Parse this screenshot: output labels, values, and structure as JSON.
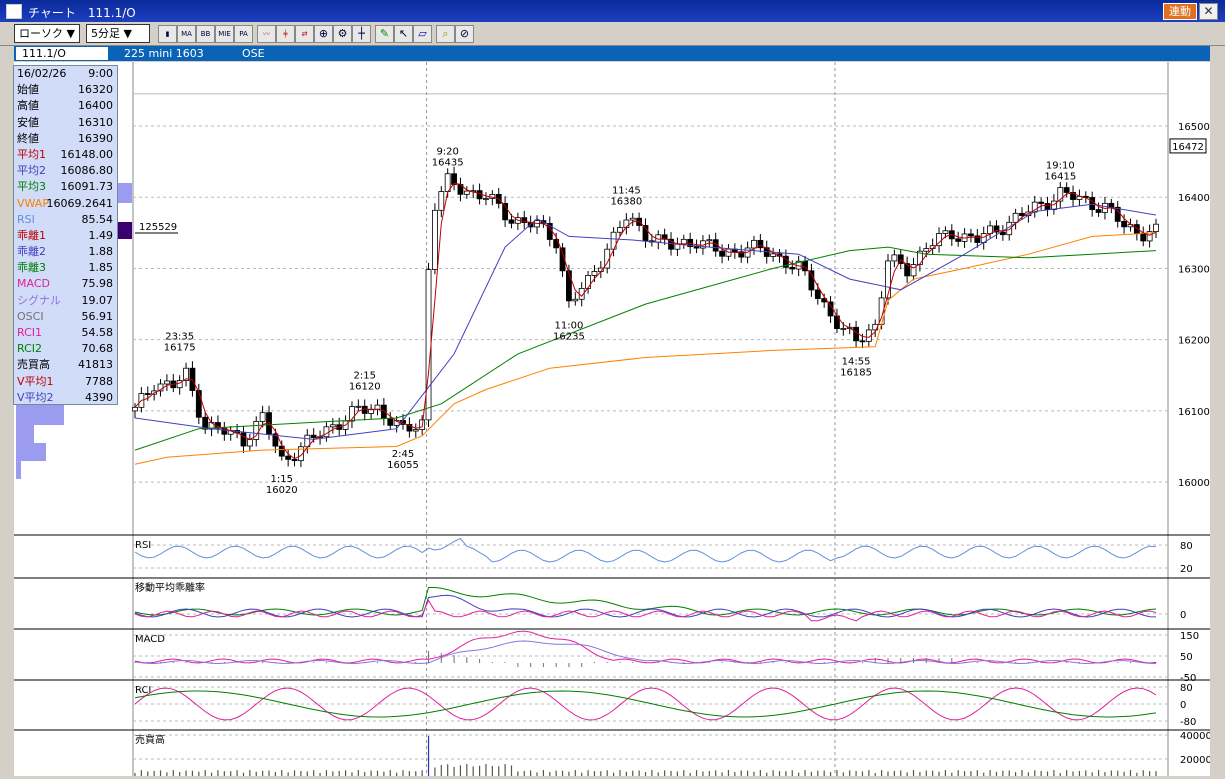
{
  "window": {
    "title": "チャート　111.1/O",
    "sync_label": "連動",
    "close_label": "✕"
  },
  "toolbar": {
    "chart_type": "ローソク ▼",
    "interval": "5分足 ▼",
    "tools": [
      "MA",
      "BB",
      "MIE",
      "PA",
      "line-chart-icon",
      "candle-icon",
      "swap-icon",
      "zoom-icon",
      "settings-icon",
      "crosshair-icon",
      "pen-icon",
      "cursor-icon",
      "eraser-icon",
      "search-icon",
      "clear-icon"
    ]
  },
  "infobar": {
    "symbol": "111.1/O",
    "product": "225 mini 1603",
    "exchange": "OSE"
  },
  "datapanel": {
    "rows": [
      {
        "k": "16/02/26",
        "v": "9:00",
        "c": "#000"
      },
      {
        "k": "始値",
        "v": "16320",
        "c": "#000"
      },
      {
        "k": "高値",
        "v": "16400",
        "c": "#000"
      },
      {
        "k": "安値",
        "v": "16310",
        "c": "#000"
      },
      {
        "k": "終値",
        "v": "16390",
        "c": "#000"
      },
      {
        "k": "平均1",
        "v": "16148.00",
        "c": "#c00000"
      },
      {
        "k": "平均2",
        "v": "16086.80",
        "c": "#4040c0"
      },
      {
        "k": "平均3",
        "v": "16091.73",
        "c": "#008000"
      },
      {
        "k": "VWAP",
        "v": "16069.2641",
        "c": "#ff8000"
      },
      {
        "k": "RSI",
        "v": "85.54",
        "c": "#6090e0"
      },
      {
        "k": "乖離1",
        "v": "1.49",
        "c": "#c00000"
      },
      {
        "k": "乖離2",
        "v": "1.88",
        "c": "#4040c0"
      },
      {
        "k": "乖離3",
        "v": "1.85",
        "c": "#008000"
      },
      {
        "k": "MACD",
        "v": "75.98",
        "c": "#e0209a"
      },
      {
        "k": "シグナル",
        "v": "19.07",
        "c": "#9070e0"
      },
      {
        "k": "OSCI",
        "v": "56.91",
        "c": "#707070"
      },
      {
        "k": "RCI1",
        "v": "54.58",
        "c": "#e0209a"
      },
      {
        "k": "RCI2",
        "v": "70.68",
        "c": "#008000"
      },
      {
        "k": "売買高",
        "v": "41813",
        "c": "#000"
      },
      {
        "k": "V平均1",
        "v": "7788",
        "c": "#c00000"
      },
      {
        "k": "V平均2",
        "v": "4390",
        "c": "#4040c0"
      }
    ]
  },
  "volume_profile_label": "125529",
  "current_price_label": "16472",
  "colors": {
    "up": "#ffffff",
    "down": "#000000",
    "ma1": "#c00000",
    "ma2": "#4040c0",
    "ma3": "#008000",
    "vwap": "#ff8000",
    "rsi": "#6090e0",
    "macd": "#e0209a",
    "signal": "#9070e0",
    "osci": "#707070",
    "rci2": "#008000",
    "grid": "#bbbbbb"
  },
  "chart_data": {
    "type": "candlestick",
    "date": "16/02/26",
    "ylim": [
      15930,
      16580
    ],
    "yticks": [
      16000,
      16100,
      16200,
      16300,
      16400,
      16500
    ],
    "x_range": [
      0,
      160
    ],
    "annotations": [
      {
        "time": "23:35",
        "price": 16175,
        "i": 7,
        "pos": "above"
      },
      {
        "time": "1:15",
        "price": 16020,
        "i": 23,
        "pos": "below"
      },
      {
        "time": "2:15",
        "price": 16120,
        "i": 36,
        "pos": "above"
      },
      {
        "time": "2:45",
        "price": 16055,
        "i": 42,
        "pos": "below"
      },
      {
        "time": "9:20",
        "price": 16435,
        "i": 49,
        "pos": "above"
      },
      {
        "time": "11:00",
        "price": 16235,
        "i": 68,
        "pos": "below"
      },
      {
        "time": "11:45",
        "price": 16380,
        "i": 77,
        "pos": "above"
      },
      {
        "time": "14:55",
        "price": 16185,
        "i": 113,
        "pos": "below"
      },
      {
        "time": "19:10",
        "price": 16415,
        "i": 145,
        "pos": "above"
      }
    ],
    "anchors": [
      [
        0,
        16100
      ],
      [
        3,
        16140
      ],
      [
        6,
        16135
      ],
      [
        8,
        16150
      ],
      [
        11,
        16080
      ],
      [
        14,
        16070
      ],
      [
        17,
        16060
      ],
      [
        20,
        16090
      ],
      [
        23,
        16030
      ],
      [
        27,
        16055
      ],
      [
        31,
        16080
      ],
      [
        35,
        16100
      ],
      [
        38,
        16105
      ],
      [
        42,
        16070
      ],
      [
        45,
        16085
      ],
      [
        46,
        16300
      ],
      [
        47,
        16390
      ],
      [
        49,
        16420
      ],
      [
        52,
        16410
      ],
      [
        55,
        16400
      ],
      [
        59,
        16370
      ],
      [
        63,
        16360
      ],
      [
        66,
        16340
      ],
      [
        68,
        16250
      ],
      [
        71,
        16280
      ],
      [
        74,
        16330
      ],
      [
        77,
        16370
      ],
      [
        80,
        16350
      ],
      [
        84,
        16330
      ],
      [
        88,
        16340
      ],
      [
        92,
        16320
      ],
      [
        96,
        16330
      ],
      [
        100,
        16320
      ],
      [
        104,
        16300
      ],
      [
        108,
        16250
      ],
      [
        111,
        16210
      ],
      [
        113,
        16200
      ],
      [
        116,
        16220
      ],
      [
        118,
        16310
      ],
      [
        121,
        16300
      ],
      [
        124,
        16330
      ],
      [
        128,
        16350
      ],
      [
        132,
        16340
      ],
      [
        136,
        16360
      ],
      [
        140,
        16380
      ],
      [
        143,
        16395
      ],
      [
        145,
        16405
      ],
      [
        149,
        16395
      ],
      [
        152,
        16385
      ],
      [
        155,
        16360
      ],
      [
        158,
        16350
      ],
      [
        160,
        16350
      ]
    ],
    "ma2": [
      [
        0,
        16090
      ],
      [
        12,
        16075
      ],
      [
        28,
        16060
      ],
      [
        41,
        16075
      ],
      [
        50,
        16180
      ],
      [
        58,
        16330
      ],
      [
        63,
        16370
      ],
      [
        68,
        16345
      ],
      [
        78,
        16340
      ],
      [
        90,
        16330
      ],
      [
        104,
        16320
      ],
      [
        112,
        16285
      ],
      [
        120,
        16270
      ],
      [
        130,
        16320
      ],
      [
        141,
        16380
      ],
      [
        150,
        16390
      ],
      [
        160,
        16375
      ]
    ],
    "ma3": [
      [
        0,
        16045
      ],
      [
        10,
        16075
      ],
      [
        30,
        16085
      ],
      [
        41,
        16090
      ],
      [
        48,
        16110
      ],
      [
        60,
        16180
      ],
      [
        80,
        16250
      ],
      [
        100,
        16300
      ],
      [
        112,
        16325
      ],
      [
        118,
        16330
      ],
      [
        124,
        16320
      ],
      [
        140,
        16315
      ],
      [
        150,
        16320
      ],
      [
        160,
        16325
      ]
    ],
    "vwap": [
      [
        0,
        16025
      ],
      [
        5,
        16035
      ],
      [
        20,
        16045
      ],
      [
        41,
        16050
      ],
      [
        45,
        16065
      ],
      [
        50,
        16110
      ],
      [
        55,
        16130
      ],
      [
        65,
        16160
      ],
      [
        80,
        16175
      ],
      [
        100,
        16185
      ],
      [
        116,
        16190
      ],
      [
        118,
        16255
      ],
      [
        122,
        16285
      ],
      [
        130,
        16300
      ],
      [
        140,
        16320
      ],
      [
        150,
        16345
      ],
      [
        160,
        16350
      ]
    ],
    "panes": [
      {
        "name": "RSI",
        "label": "RSI",
        "ticks": [
          "80",
          "20"
        ]
      },
      {
        "name": "divergence",
        "label": "移動平均乖離率",
        "ticks": [
          "0"
        ]
      },
      {
        "name": "MACD",
        "label": "MACD",
        "ticks": [
          "150",
          "50",
          "-50"
        ]
      },
      {
        "name": "RCI",
        "label": "RCI",
        "ticks": [
          "80",
          "0",
          "-80"
        ]
      },
      {
        "name": "volume",
        "label": "売買高",
        "ticks": [
          "40000",
          "20000"
        ]
      }
    ]
  }
}
